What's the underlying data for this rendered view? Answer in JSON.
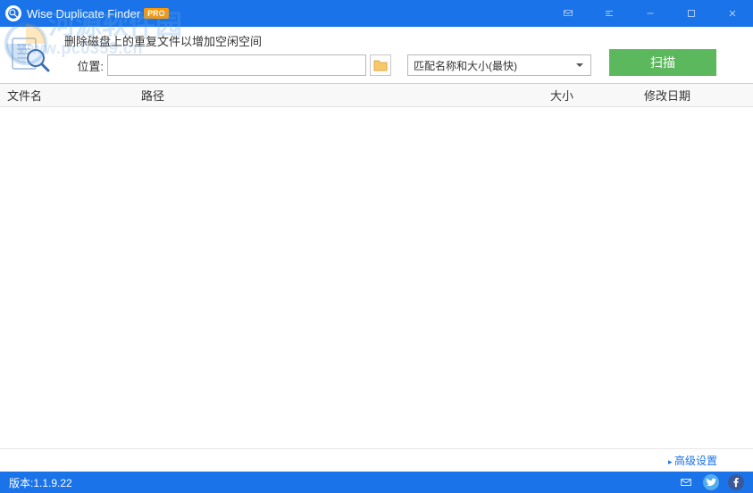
{
  "title": {
    "app_name": "Wise Duplicate Finder",
    "pro_badge": "PRO"
  },
  "watermark": {
    "cn": "河源软件园",
    "url": "www.pc0359.cn"
  },
  "toolbar": {
    "description": "删除磁盘上的重复文件以增加空闲空间",
    "location_label": "位置:",
    "location_value": "",
    "match_mode_selected": "匹配名称和大小(最快)",
    "scan_label": "扫描"
  },
  "columns": {
    "filename": "文件名",
    "path": "路径",
    "size": "大小",
    "modified": "修改日期"
  },
  "footer": {
    "advanced_link": "高级设置",
    "version_label": "版本:1.1.9.22"
  }
}
